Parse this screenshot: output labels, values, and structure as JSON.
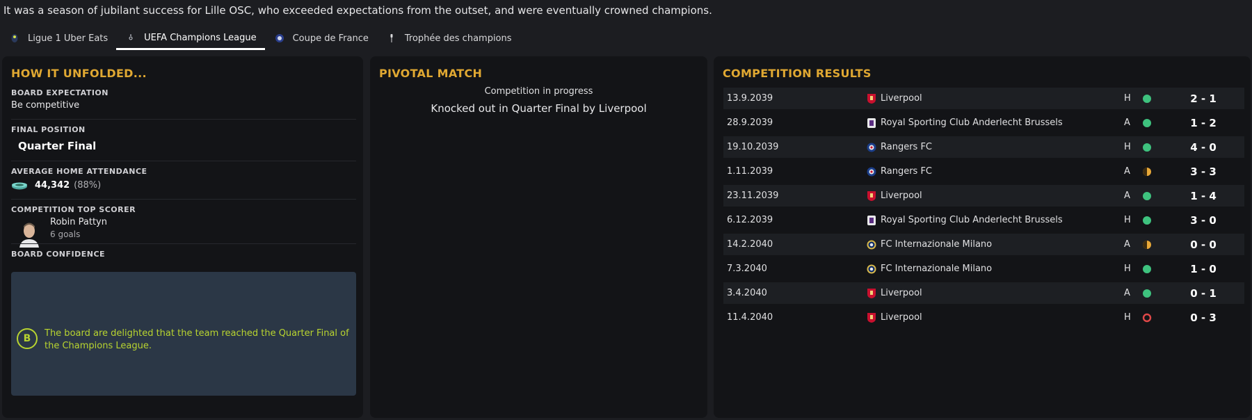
{
  "summary": "It was a season of jubilant success for Lille OSC, who exceeded expectations from the outset, and were eventually crowned champions.",
  "tabs": [
    {
      "label": "Ligue 1 Uber Eats",
      "icon": "ligue1-icon"
    },
    {
      "label": "UEFA Champions League",
      "icon": "ucl-icon",
      "active": true
    },
    {
      "label": "Coupe de France",
      "icon": "coupe-de-france-icon"
    },
    {
      "label": "Trophée des champions",
      "icon": "trophee-icon"
    }
  ],
  "left": {
    "title": "HOW IT UNFOLDED...",
    "board_expectation_label": "BOARD EXPECTATION",
    "board_expectation": "Be competitive",
    "final_position_label": "FINAL POSITION",
    "final_position": "Quarter Final",
    "attendance_label": "AVERAGE HOME ATTENDANCE",
    "attendance": "44,342",
    "attendance_pct": "(88%)",
    "top_scorer_label": "COMPETITION TOP SCORER",
    "top_scorer_name": "Robin Pattyn",
    "top_scorer_goals": "6 goals",
    "board_confidence_label": "BOARD CONFIDENCE",
    "board_confidence_grade": "B",
    "board_confidence_text": "The board are delighted that the team reached the Quarter Final of the Champions League."
  },
  "middle": {
    "title": "PIVOTAL MATCH",
    "status": "Competition in progress",
    "result_text": "Knocked out in Quarter Final by Liverpool"
  },
  "right": {
    "title": "COMPETITION RESULTS",
    "results": [
      {
        "date": "13.9.2039",
        "team": "Liverpool",
        "crest": "liverpool",
        "venue": "H",
        "outcome": "win",
        "score": "2 - 1"
      },
      {
        "date": "28.9.2039",
        "team": "Royal Sporting Club Anderlecht Brussels",
        "crest": "anderlecht",
        "venue": "A",
        "outcome": "win",
        "score": "1 - 2"
      },
      {
        "date": "19.10.2039",
        "team": "Rangers FC",
        "crest": "rangers",
        "venue": "H",
        "outcome": "win",
        "score": "4 - 0"
      },
      {
        "date": "1.11.2039",
        "team": "Rangers FC",
        "crest": "rangers",
        "venue": "A",
        "outcome": "draw",
        "score": "3 - 3"
      },
      {
        "date": "23.11.2039",
        "team": "Liverpool",
        "crest": "liverpool",
        "venue": "A",
        "outcome": "win",
        "score": "1 - 4"
      },
      {
        "date": "6.12.2039",
        "team": "Royal Sporting Club Anderlecht Brussels",
        "crest": "anderlecht",
        "venue": "H",
        "outcome": "win",
        "score": "3 - 0"
      },
      {
        "date": "14.2.2040",
        "team": "FC Internazionale Milano",
        "crest": "inter",
        "venue": "A",
        "outcome": "draw",
        "score": "0 - 0"
      },
      {
        "date": "7.3.2040",
        "team": "FC Internazionale Milano",
        "crest": "inter",
        "venue": "H",
        "outcome": "win",
        "score": "1 - 0"
      },
      {
        "date": "3.4.2040",
        "team": "Liverpool",
        "crest": "liverpool",
        "venue": "A",
        "outcome": "win",
        "score": "0 - 1"
      },
      {
        "date": "11.4.2040",
        "team": "Liverpool",
        "crest": "liverpool",
        "venue": "H",
        "outcome": "loss",
        "score": "0 - 3"
      }
    ]
  },
  "colors": {
    "accent": "#e0a832",
    "win": "#3ec27e",
    "draw": "#e8a838",
    "loss": "#e04848",
    "confidence": "#b8d430"
  }
}
